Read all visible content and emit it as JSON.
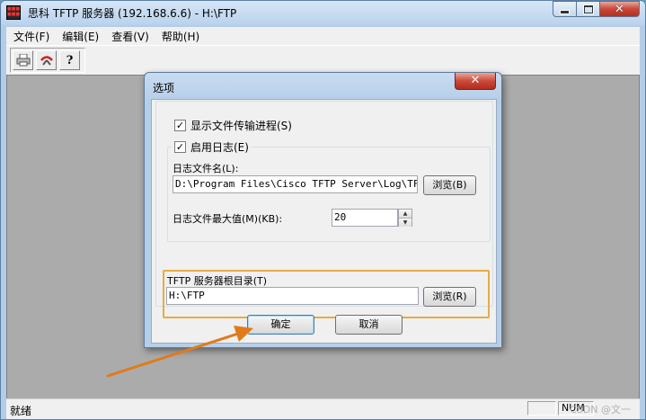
{
  "window": {
    "title": "思科 TFTP 服务器 (192.168.6.6) - H:\\FTP",
    "icon_name": "cisco-tftp-app-icon",
    "caption_close": "✕"
  },
  "menu": {
    "items": [
      "文件(F)",
      "编辑(E)",
      "查看(V)",
      "帮助(H)"
    ]
  },
  "toolbar": {
    "buttons": [
      "print-icon",
      "options-icon",
      "help-icon"
    ],
    "help_glyph": "?"
  },
  "statusbar": {
    "text": "就绪",
    "num": "NUM",
    "watermark": "CSDN @文一"
  },
  "dialog": {
    "title": "选项",
    "close": "✕",
    "show_progress": {
      "label": "显示文件传输进程(S)",
      "checked": true,
      "mark": "✓"
    },
    "enable_log": {
      "label": "启用日志(E)",
      "checked": true,
      "mark": "✓"
    },
    "log_file_label": "日志文件名(L):",
    "log_file_value": "D:\\Program Files\\Cisco TFTP Server\\Log\\TFTPS",
    "browse_log": "浏览(B)",
    "log_max_label": "日志文件最大值(M)(KB):",
    "log_max_value": "20",
    "spin_up": "▲",
    "spin_down": "▼",
    "root_label": "TFTP 服务器根目录(T)",
    "root_value": "H:\\FTP",
    "browse_root": "浏览(R)",
    "ok": "确定",
    "cancel": "取消"
  },
  "colors": {
    "highlight_border": "#e4ad45",
    "arrow": "#e07b1a"
  }
}
